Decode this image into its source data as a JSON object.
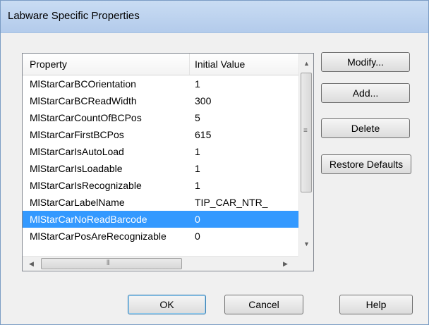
{
  "window": {
    "title": "Labware Specific Properties"
  },
  "list": {
    "headers": {
      "property": "Property",
      "initial_value": "Initial Value"
    },
    "rows": [
      {
        "name": "MlStarCarBCOrientation",
        "value": "1"
      },
      {
        "name": "MlStarCarBCReadWidth",
        "value": "300"
      },
      {
        "name": "MlStarCarCountOfBCPos",
        "value": "5"
      },
      {
        "name": "MlStarCarFirstBCPos",
        "value": "615"
      },
      {
        "name": "MlStarCarIsAutoLoad",
        "value": "1"
      },
      {
        "name": "MlStarCarIsLoadable",
        "value": "1"
      },
      {
        "name": "MlStarCarIsRecognizable",
        "value": "1"
      },
      {
        "name": "MlStarCarLabelName",
        "value": "TIP_CAR_NTR_"
      },
      {
        "name": "MlStarCarNoReadBarcode",
        "value": "0"
      },
      {
        "name": "MlStarCarPosAreRecognizable",
        "value": "0"
      }
    ],
    "selected_row": "MlStarCarNoReadBarcode"
  },
  "side_buttons": {
    "modify": "Modify...",
    "add": "Add...",
    "delete": "Delete",
    "restore": "Restore Defaults"
  },
  "bottom_buttons": {
    "ok": "OK",
    "cancel": "Cancel",
    "help": "Help"
  },
  "colors": {
    "selection": "#3399ff",
    "titlebar": "#b9d1ea",
    "dialog_bg": "#f0f0f0"
  }
}
